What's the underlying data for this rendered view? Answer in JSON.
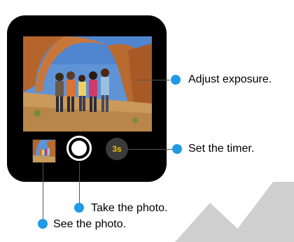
{
  "timer_button": {
    "label": "3s"
  },
  "callouts": {
    "exposure": "Adjust exposure.",
    "timer": "Set the timer.",
    "take_photo": "Take the photo.",
    "see_photo": "See the photo."
  },
  "colors": {
    "watch_body": "#000000",
    "callout_dot": "#1f9be6",
    "timer_text": "#f0c000",
    "timer_bg": "#3a3a3a",
    "leader_line": "#555555"
  },
  "icons": {
    "shutter": "shutter-button-icon",
    "thumbnail": "photo-thumbnail-icon",
    "timer": "timer-icon"
  }
}
